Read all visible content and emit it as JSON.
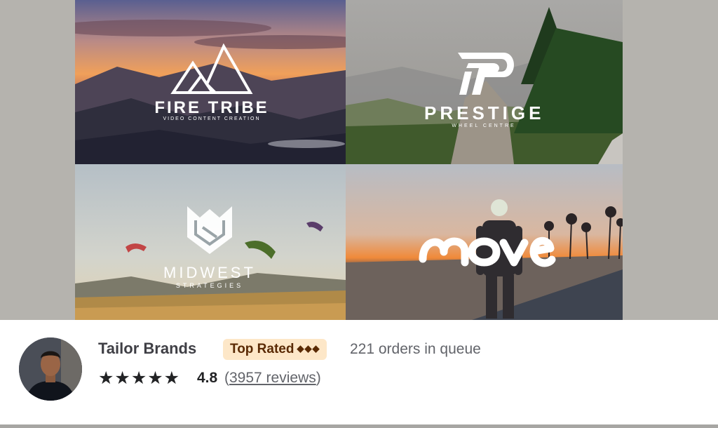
{
  "gallery": {
    "tiles": [
      {
        "logo_name": "FIRE TRIBE",
        "tagline": "VIDEO CONTENT CREATION",
        "icon": "mountain-peaks-icon"
      },
      {
        "logo_name": "PRESTIGE",
        "tagline": "WHEEL CENTRE",
        "icon": "stylized-p-icon"
      },
      {
        "logo_name": "MIDWEST",
        "tagline": "STRATEGIES",
        "icon": "shield-m-icon"
      },
      {
        "logo_name": "move",
        "tagline": "",
        "icon": "wave-wordmark"
      }
    ]
  },
  "seller": {
    "name": "Tailor Brands",
    "badge": "Top Rated",
    "badge_icon": "◆◆◆",
    "queue": "221 orders in queue",
    "stars": "★★★★★",
    "rating": "4.8",
    "reviews_open": "(",
    "reviews": "3957 reviews",
    "reviews_close": ")"
  },
  "colors": {
    "badge_bg": "#fde7c8",
    "badge_text": "#5a2a04",
    "star": "#222325"
  }
}
